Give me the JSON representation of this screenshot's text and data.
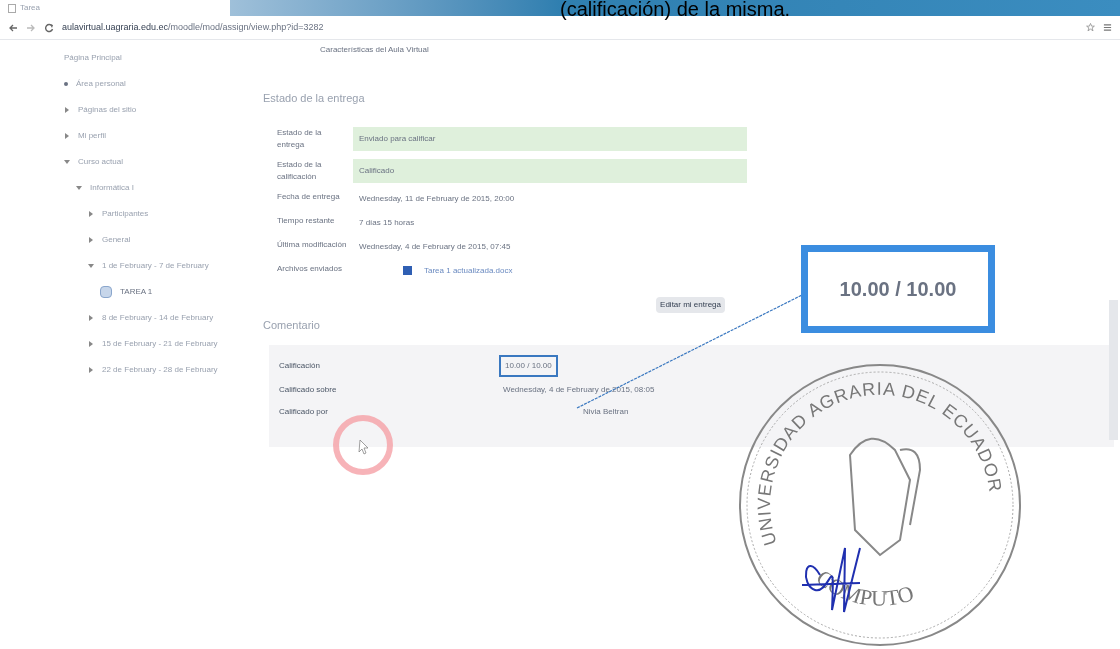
{
  "caption_fragment": "(calificación) de la misma.",
  "browser": {
    "tab_title": "Tarea",
    "url_host": "aulavirtual.uagraria.edu.ec",
    "url_path": "/moodle/mod/assign/view.php?id=3282"
  },
  "page_header": "Características del Aula Virtual",
  "sidebar": {
    "items": [
      {
        "label": "Página Principal",
        "kind": "link"
      },
      {
        "label": "Área personal",
        "kind": "bullet"
      },
      {
        "label": "Páginas del sitio",
        "kind": "node",
        "expanded": false
      },
      {
        "label": "Mi perfil",
        "kind": "node",
        "expanded": false
      },
      {
        "label": "Curso actual",
        "kind": "node",
        "expanded": true,
        "children": [
          {
            "label": "Informática I",
            "kind": "node",
            "expanded": true,
            "children": [
              {
                "label": "Participantes",
                "kind": "node",
                "expanded": false
              },
              {
                "label": "General",
                "kind": "node",
                "expanded": false
              },
              {
                "label": "1 de February - 7 de February",
                "kind": "node",
                "expanded": true,
                "children": [
                  {
                    "label": "TAREA 1",
                    "kind": "activity"
                  }
                ]
              },
              {
                "label": "8 de February - 14 de February",
                "kind": "node",
                "expanded": false
              },
              {
                "label": "15 de February - 21 de February",
                "kind": "node",
                "expanded": false
              },
              {
                "label": "22 de February - 28 de February",
                "kind": "node",
                "expanded": false
              }
            ]
          }
        ]
      }
    ]
  },
  "submission_status": {
    "heading": "Estado de la entrega",
    "rows": [
      {
        "label": "Estado de la entrega",
        "value": "Enviado para calificar",
        "highlight": true,
        "kind": "text"
      },
      {
        "label": "Estado de la calificación",
        "value": "Calificado",
        "highlight": true,
        "kind": "text"
      },
      {
        "label": "Fecha de entrega",
        "value": "Wednesday, 11 de February de 2015, 20:00",
        "highlight": false,
        "kind": "text"
      },
      {
        "label": "Tiempo restante",
        "value": "7 días 15 horas",
        "highlight": false,
        "kind": "text"
      },
      {
        "label": "Última modificación",
        "value": "Wednesday, 4 de February de 2015, 07:45",
        "highlight": false,
        "kind": "text"
      },
      {
        "label": "Archivos enviados",
        "value": "Tarea 1 actualizada.docx",
        "highlight": false,
        "kind": "file"
      }
    ],
    "edit_button": "Editar mi entrega"
  },
  "feedback": {
    "heading": "Comentario",
    "rows": [
      {
        "label": "Calificación",
        "value": "10.00 / 10.00",
        "boxed": true
      },
      {
        "label": "Calificado sobre",
        "value": "Wednesday, 4 de February de 2015, 08:05",
        "boxed": false
      },
      {
        "label": "Calificado por",
        "value": "Nivia Beltran",
        "boxed": false
      }
    ]
  },
  "callout": {
    "text": "10.00 / 10.00"
  },
  "stamp": {
    "top_text": "UNIVERSIDAD AGRARIA DEL ECUADOR",
    "bottom_text": "COMPUTO"
  }
}
